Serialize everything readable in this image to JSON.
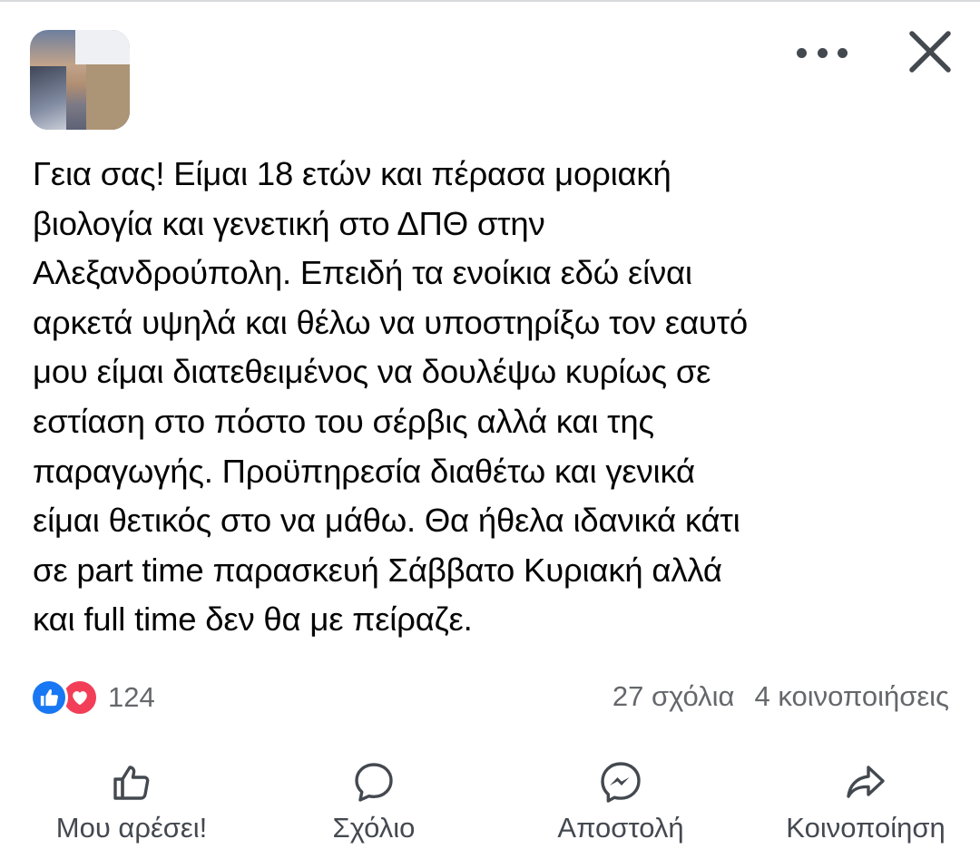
{
  "post": {
    "text": "Γεια σας! Είμαι 18 ετών και πέρασα μοριακή\nβιολογία και γενετική στο ΔΠΘ στην\nΑλεξανδρούπολη. Επειδή τα ενοίκια εδώ είναι\nαρκετά υψηλά και θέλω να υποστηρίξω τον εαυτό\nμου είμαι διατεθειμένος να δουλέψω κυρίως σε\nεστίαση στο πόστο του σέρβις αλλά και της\nπαραγωγής. Προϋπηρεσία διαθέτω και γενικά\nείμαι θετικός στο να μάθω. Θα ήθελα ιδανικά κάτι\nσε part time παρασκευή Σάββατο Κυριακή αλλά\nκαι full time δεν θα με πείραζε."
  },
  "header": {
    "avatar_icon": "profile-photo",
    "more_icon": "more-dots-icon",
    "close_icon": "close-icon"
  },
  "stats": {
    "reactions_count": "124",
    "comments": "27 σχόλια",
    "shares": "4 κοινοποιήσεις"
  },
  "actions": {
    "like_label": "Μου αρέσει!",
    "comment_label": "Σχόλιο",
    "send_label": "Αποστολή",
    "share_label": "Κοινοποίηση"
  },
  "colors": {
    "like_blue": "#1877f2",
    "love_red": "#f33e58",
    "secondary_text": "#65676b",
    "action_text": "#444950"
  }
}
